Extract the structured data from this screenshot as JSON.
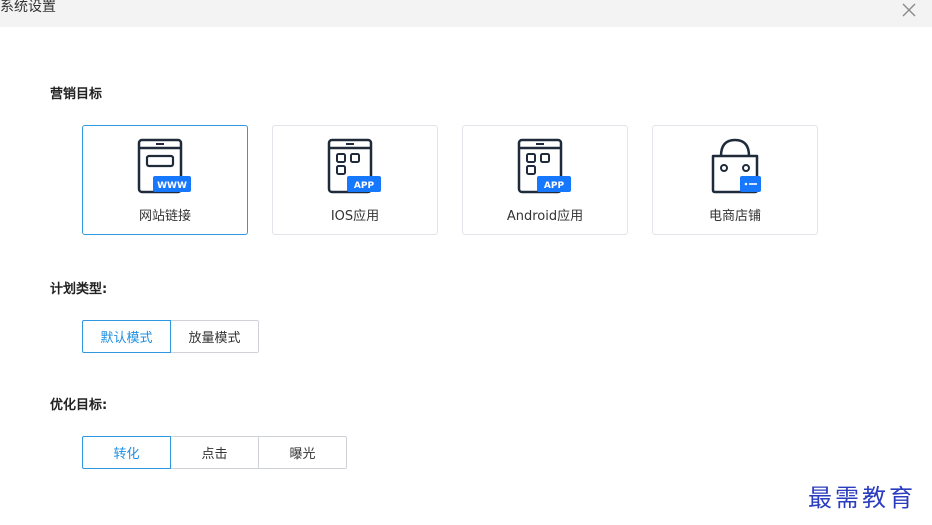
{
  "window": {
    "title": "系统设置",
    "close_icon": "close-icon"
  },
  "marketing_goal": {
    "label": "营销目标",
    "cards": [
      {
        "label": "网站链接",
        "icon": "web-link-icon",
        "badge": "WWW",
        "selected": true
      },
      {
        "label": "IOS应用",
        "icon": "ios-app-icon",
        "badge": "APP",
        "selected": false
      },
      {
        "label": "Android应用",
        "icon": "android-app-icon",
        "badge": "APP",
        "selected": false
      },
      {
        "label": "电商店铺",
        "icon": "shop-icon",
        "badge": "",
        "selected": false
      }
    ]
  },
  "plan_type": {
    "label": "计划类型:",
    "options": [
      {
        "label": "默认模式",
        "active": true
      },
      {
        "label": "放量模式",
        "active": false
      }
    ]
  },
  "optimize_goal": {
    "label": "优化目标:",
    "options": [
      {
        "label": "转化",
        "active": true
      },
      {
        "label": "点击",
        "active": false
      },
      {
        "label": "曝光",
        "active": false
      }
    ]
  },
  "watermark": {
    "text": "最需教育"
  },
  "colors": {
    "accent": "#2f97e0",
    "icon_blue": "#1677ff",
    "dark_icon": "#1f2b3a",
    "watermark": "#2b3dbf"
  }
}
